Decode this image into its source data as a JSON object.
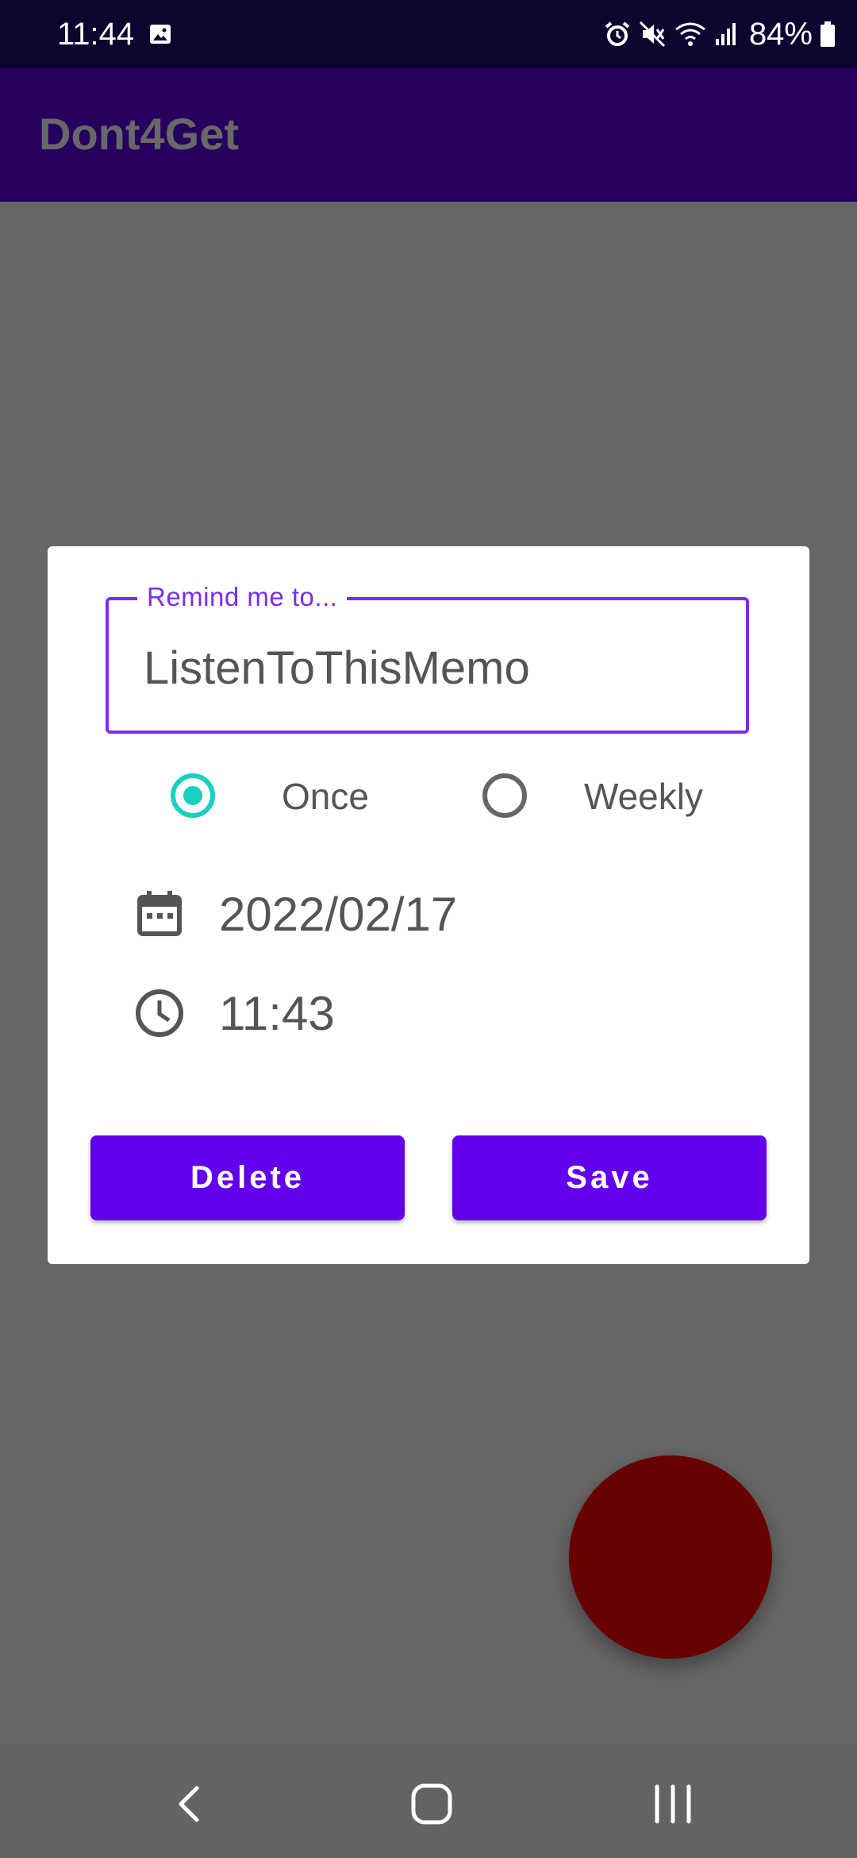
{
  "status_bar": {
    "time": "11:44",
    "battery": "84%",
    "icons": [
      "gallery-icon",
      "alarm-icon",
      "mute-icon",
      "wifi-icon",
      "signal-icon",
      "battery-icon"
    ]
  },
  "app_bar": {
    "title": "Dont4Get"
  },
  "dialog": {
    "field_label": "Remind me to...",
    "field_value": "ListenToThisMemo",
    "radio_options": [
      {
        "label": "Once",
        "selected": true
      },
      {
        "label": "Weekly",
        "selected": false
      }
    ],
    "date": "2022/02/17",
    "time": "11:43",
    "delete_label": "Delete",
    "save_label": "Save"
  },
  "colors": {
    "status_bar": "#0e0430",
    "app_bar": "#27005f",
    "accent": "#6200ee",
    "field_outline": "#7c2cf0",
    "radio_selected": "#1ad0c0",
    "fab": "#680000",
    "scrim": "#666666"
  },
  "nav_bar": {
    "icons": [
      "back-icon",
      "home-icon",
      "recents-icon"
    ]
  }
}
